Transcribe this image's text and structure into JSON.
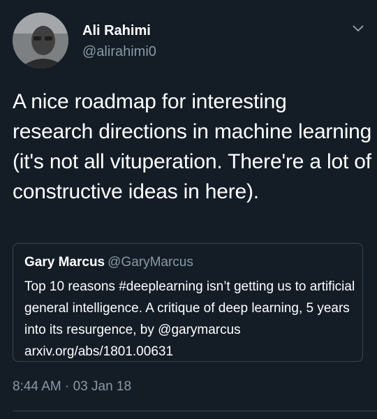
{
  "author": {
    "name": "Ali Rahimi",
    "handle": "@alirahimi0"
  },
  "tweet": {
    "text": "A nice roadmap for interesting research directions in machine learning (it's not all vituperation. There're a lot of constructive ideas in here).",
    "timestamp": "8:44 AM · 03 Jan 18"
  },
  "quoted_tweet": {
    "name": "Gary Marcus",
    "handle": "@GaryMarcus",
    "text": "Top 10 reasons #deeplearning isn’t getting us to artificial general intelligence. A critique of deep learning, 5 years into its resurgence, by @garymarcus  arxiv.org/abs/1801.00631"
  },
  "icons": {
    "menu": "chevron-down-icon",
    "avatar": "user-photo"
  },
  "colors": {
    "background": "#141d26",
    "primary_text": "#ffffff",
    "secondary_text": "#8899a6",
    "border": "#38444d"
  }
}
